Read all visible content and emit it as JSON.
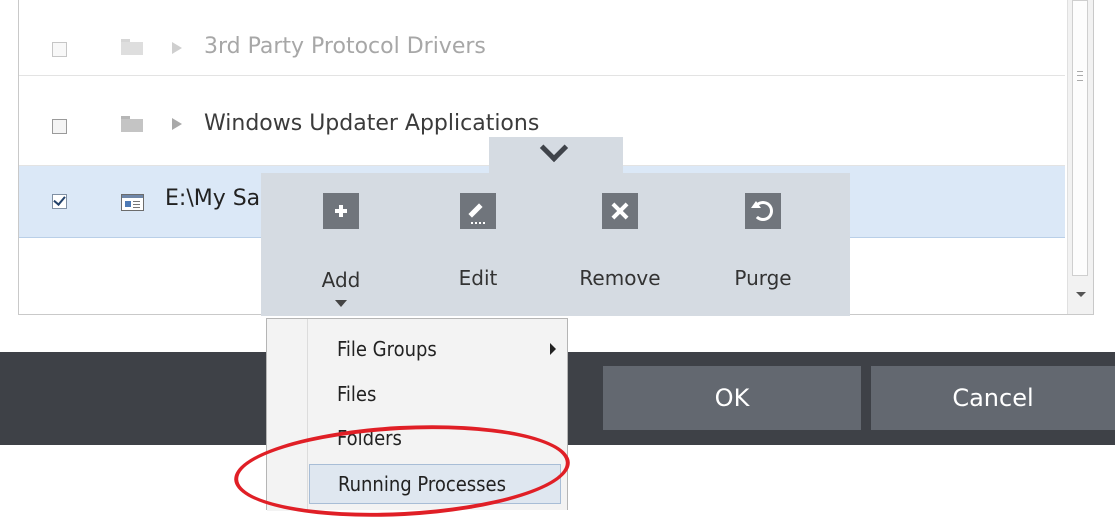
{
  "list": {
    "rows": [
      {
        "label": "3rd Party Protocol Drivers",
        "checked": false,
        "icon": "folder-icon",
        "expandable": true
      },
      {
        "label": "Windows Updater Applications",
        "checked": false,
        "icon": "folder-icon",
        "expandable": true
      },
      {
        "label": "E:\\My Sa",
        "checked": true,
        "icon": "application-icon",
        "selected": true
      }
    ]
  },
  "toolbar": {
    "add_label": "Add",
    "edit_label": "Edit",
    "remove_label": "Remove",
    "purge_label": "Purge"
  },
  "add_menu": {
    "items": [
      "File Groups",
      "Files",
      "Folders",
      "Running Processes"
    ],
    "highlighted": "Running Processes"
  },
  "dialog_buttons": {
    "ok_label": "OK",
    "cancel_label": "Cancel"
  },
  "colors": {
    "selected_row": "#dbe8f7",
    "toolbar_bg": "#d5dbe2",
    "icon_tile": "#70757c",
    "bottom_bar": "#3e4147",
    "button_bg": "#636870",
    "annotation": "#e01f26"
  }
}
